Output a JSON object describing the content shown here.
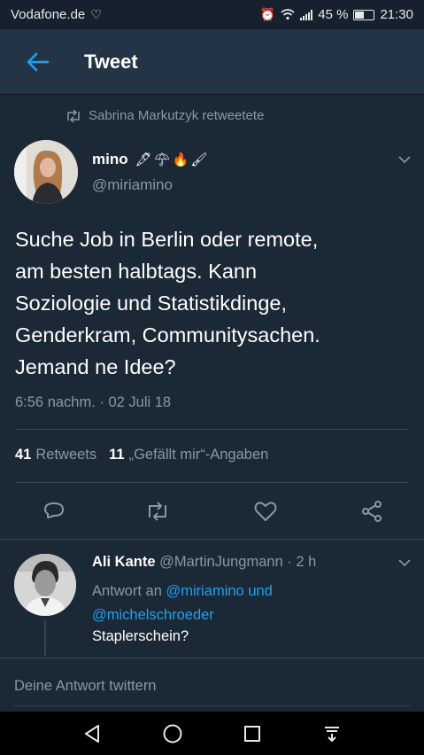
{
  "status_bar": {
    "carrier": "Vodafone.de",
    "battery_percent": "45 %",
    "battery_level": 0.45,
    "time": "21:30"
  },
  "header": {
    "title": "Tweet"
  },
  "retweet_notice": "Sabrina Markutzyk retweetete",
  "tweet": {
    "display_name": "mino",
    "emoji": "🖋☂🔥🖌",
    "handle": "@miriamino",
    "text": "Suche Job in Berlin oder remote,\nam besten halbtags. Kann\nSoziologie und Statistikdinge,\nGenderkram, Communitysachen.\nJemand ne Idee?",
    "timestamp": "6:56 nachm. · 02 Juli 18",
    "retweet_count": "41",
    "retweet_label": "Retweets",
    "like_count": "11",
    "like_label": "„Gefällt mir“-Angaben"
  },
  "reply": {
    "display_name": "Ali Kante",
    "handle_time": "@MartinJungmann · 2 h",
    "reply_prefix": "Antwort an",
    "mention_1": "@miriamino und",
    "mention_2": "@michelschroeder",
    "text": "Staplerschein?"
  },
  "compose": {
    "placeholder": "Deine Antwort twittern"
  },
  "colors": {
    "background": "#1b2836",
    "header": "#243447",
    "accent": "#1da1f2",
    "secondary_text": "#8899a6"
  },
  "icons": [
    "alarm-icon",
    "wifi-icon",
    "signal-icon",
    "battery-icon",
    "back-arrow-icon",
    "retweet-icon",
    "chevron-down-icon",
    "reply-icon",
    "like-icon",
    "share-icon",
    "nav-back-icon",
    "nav-home-icon",
    "nav-recents-icon",
    "nav-notifications-icon"
  ]
}
